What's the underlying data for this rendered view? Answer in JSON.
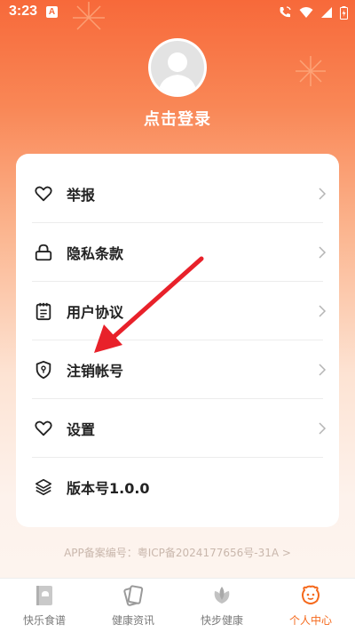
{
  "status_bar": {
    "time": "3:23",
    "app_notice_icon": "a-icon",
    "right_icons": [
      "wifi-calling-icon",
      "wifi-icon",
      "signal-icon",
      "battery-icon"
    ]
  },
  "profile": {
    "login_label": "点击登录",
    "avatar_icon": "default-avatar-icon"
  },
  "menu": {
    "items": [
      {
        "label": "举报",
        "icon": "heart-icon"
      },
      {
        "label": "隐私条款",
        "icon": "lock-icon"
      },
      {
        "label": "用户协议",
        "icon": "clipboard-icon"
      },
      {
        "label": "注销帐号",
        "icon": "shield-icon"
      },
      {
        "label": "设置",
        "icon": "heart-icon"
      },
      {
        "label": "版本号1.0.0",
        "icon": "layers-icon"
      }
    ]
  },
  "icp": {
    "text": "APP备案编号：粤ICP备2024177656号-31A >"
  },
  "tabbar": {
    "tabs": [
      {
        "label": "快乐食谱",
        "icon": "book-icon",
        "active": false
      },
      {
        "label": "健康资讯",
        "icon": "cards-icon",
        "active": false
      },
      {
        "label": "快步健康",
        "icon": "leaf-icon",
        "active": false
      },
      {
        "label": "个人中心",
        "icon": "smiley-icon",
        "active": true
      }
    ]
  },
  "colors": {
    "accent": "#f5691c",
    "header_top": "#f7693a",
    "arrow": "#e8212a"
  }
}
